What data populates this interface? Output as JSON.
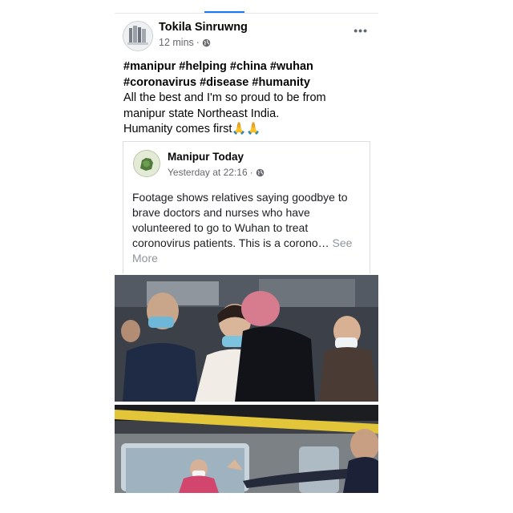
{
  "post": {
    "author": "Tokila Sinruwng",
    "time": "12 mins",
    "separator": "·",
    "menu": "•••",
    "hashtags_line1": "#manipur #helping #china #wuhan",
    "hashtags_line2": "#coronavirus #disease #humanity",
    "body_line1": "All the best and I'm so proud to be from",
    "body_line2": "manipur state Northeast India.",
    "body_line3": "Humanity comes first🙏🙏"
  },
  "shared": {
    "author": "Manipur Today",
    "time": "Yesterday at 22:16",
    "separator": "·",
    "text": "Footage shows relatives saying goodbye to brave doctors and nurses who have volunteered to go to Wuhan to treat coronovirus patients. This is a corono…",
    "see_more": "See More"
  },
  "icons": {
    "privacy": "globe-icon",
    "menu": "more-options-icon"
  },
  "colors": {
    "accent": "#1877f2",
    "meta_text": "#65676b",
    "see_more": "#90949c"
  }
}
